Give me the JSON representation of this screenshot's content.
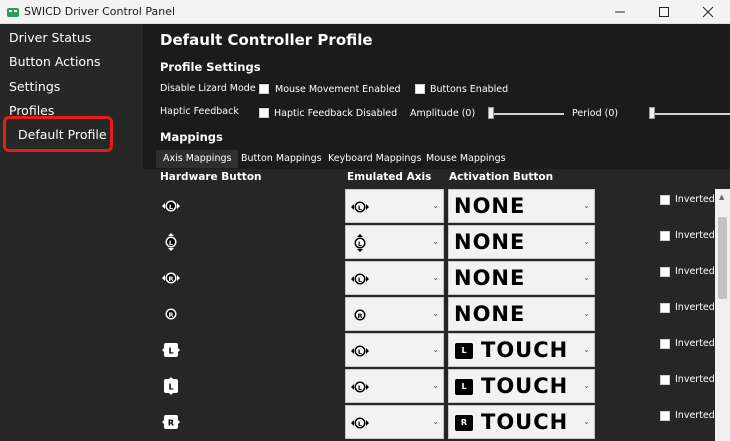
{
  "window": {
    "title": "SWICD Driver Control Panel"
  },
  "sidebar": {
    "items": [
      {
        "label": "Driver Status"
      },
      {
        "label": "Button Actions"
      },
      {
        "label": "Settings"
      },
      {
        "label": "Profiles"
      }
    ],
    "sub_item": {
      "label": "Default Profile"
    },
    "highlight_color": "#e81b1b"
  },
  "main": {
    "title": "Default Controller Profile",
    "profile_settings": {
      "heading": "Profile Settings",
      "disable_lizard_label": "Disable Lizard Mode",
      "mouse_movement_label": "Mouse Movement Enabled",
      "buttons_enabled_label": "Buttons Enabled",
      "haptic_label": "Haptic Feedback",
      "haptic_disabled_label": "Haptic Feedback Disabled",
      "amplitude_label": "Amplitude (0)",
      "period_label": "Period (0)"
    },
    "mappings": {
      "heading": "Mappings",
      "tabs": [
        {
          "label": "Axis Mappings",
          "active": true
        },
        {
          "label": "Button Mappings",
          "active": false
        },
        {
          "label": "Keyboard Mappings",
          "active": false
        },
        {
          "label": "Mouse Mappings",
          "active": false
        }
      ],
      "columns": {
        "hardware": "Hardware Button",
        "emulated": "Emulated Axis",
        "activation": "Activation Button"
      },
      "rows": [
        {
          "hw_icon": "left-stick-horizontal-icon",
          "axis_icon": "left-stick-horizontal-icon",
          "activation": "NONE",
          "badge": "",
          "inverted_label": "Inverted"
        },
        {
          "hw_icon": "left-stick-vertical-icon",
          "axis_icon": "left-stick-vertical-icon",
          "activation": "NONE",
          "badge": "",
          "inverted_label": "Inverted"
        },
        {
          "hw_icon": "right-stick-horizontal-icon",
          "axis_icon": "left-stick-horizontal-icon",
          "activation": "NONE",
          "badge": "",
          "inverted_label": "Inverted"
        },
        {
          "hw_icon": "right-stick-vertical-icon",
          "axis_icon": "right-stick-vertical-icon",
          "activation": "NONE",
          "badge": "",
          "inverted_label": "Inverted"
        },
        {
          "hw_icon": "left-trackpad-horizontal-icon",
          "axis_icon": "left-stick-horizontal-icon",
          "activation": "TOUCH",
          "badge": "L",
          "inverted_label": "Inverted"
        },
        {
          "hw_icon": "left-trackpad-vertical-icon",
          "axis_icon": "left-stick-horizontal-icon",
          "activation": "TOUCH",
          "badge": "L",
          "inverted_label": "Inverted"
        },
        {
          "hw_icon": "right-trackpad-horizontal-icon",
          "axis_icon": "left-stick-horizontal-icon",
          "activation": "TOUCH",
          "badge": "R",
          "inverted_label": "Inverted"
        }
      ]
    }
  }
}
